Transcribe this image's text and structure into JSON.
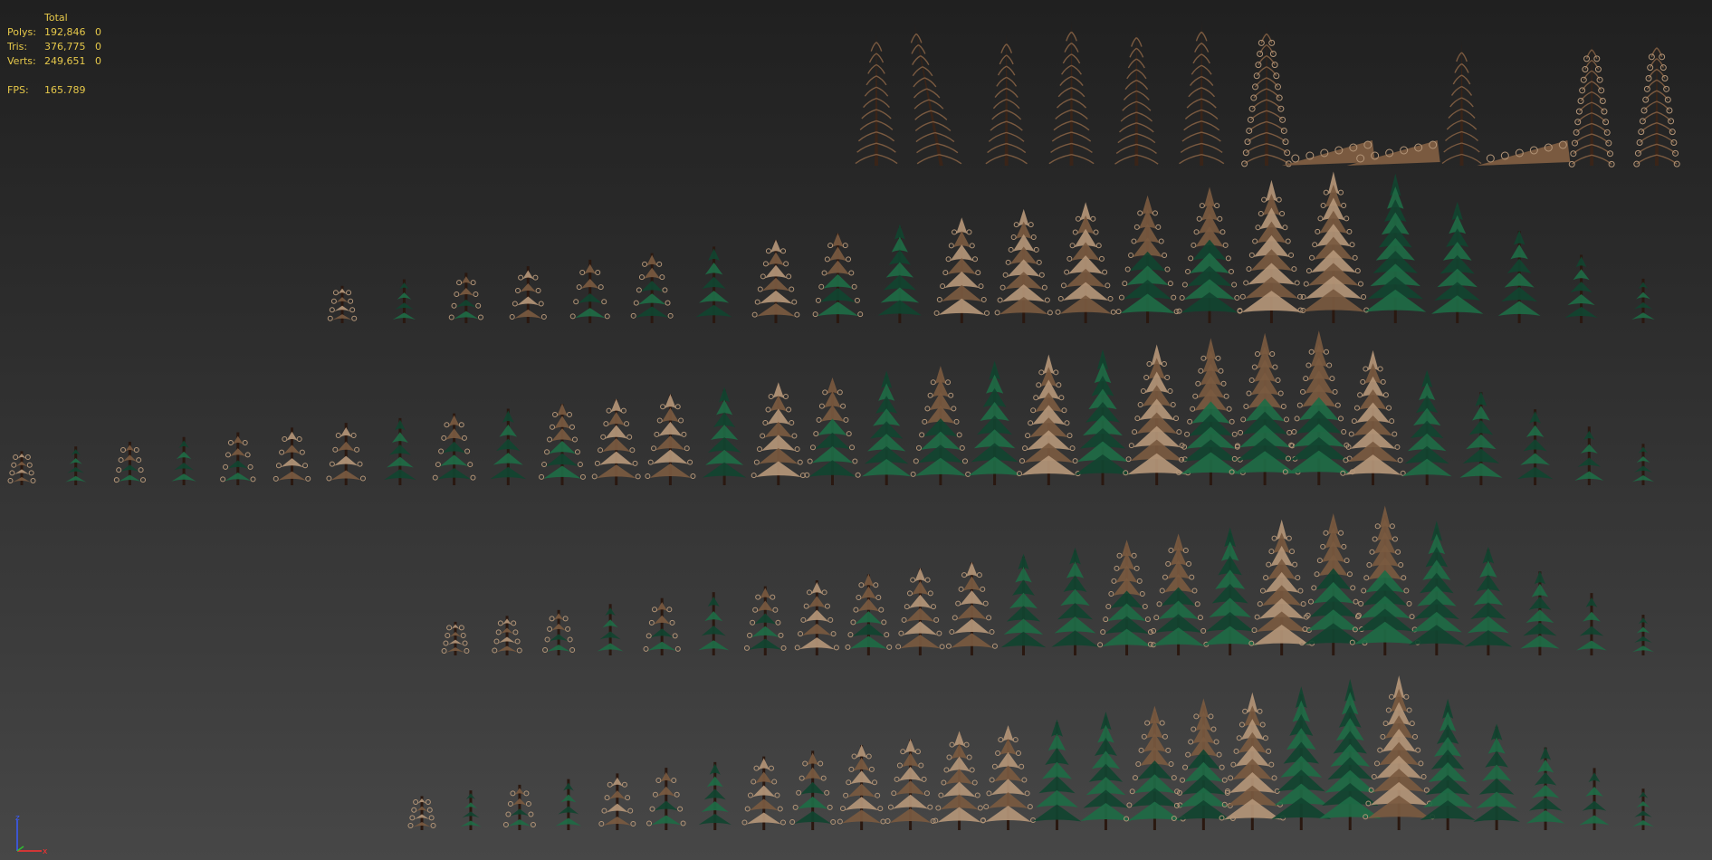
{
  "stats": {
    "header": "Total",
    "rows": [
      {
        "label": "Polys:",
        "total": "192,846",
        "selected": "0"
      },
      {
        "label": "Tris:",
        "total": "376,775",
        "selected": "0"
      },
      {
        "label": "Verts:",
        "total": "249,651",
        "selected": "0"
      }
    ],
    "fps_label": "FPS:",
    "fps_value": "165.789"
  },
  "gizmo": {
    "z_label": "z",
    "x_label": "x",
    "z_color": "#3a5cff",
    "x_color": "#ff3030",
    "y_color": "#30c030"
  },
  "colors": {
    "hud_text": "#e6c84a",
    "tree_green": "#1e6b45",
    "tree_green_dark": "#114430",
    "tree_brown": "#7a5a40",
    "tree_brown_light": "#b49678",
    "trunk": "#2a1810"
  },
  "tree_rows": [
    {
      "name": "row-1-dead-trees",
      "trees": [
        "dead-pine",
        "dead-pine-leaning",
        "dead-pine",
        "dead-pine",
        "dead-pine",
        "dead-pine",
        "curly-pine",
        "fallen-log",
        "fallen-log",
        "dead-sapling",
        "fallen-log",
        "curly-sapling",
        "curly-sapling"
      ]
    },
    {
      "name": "row-2",
      "trees": [
        "brown",
        "green",
        "mixed",
        "brown",
        "mixed",
        "mixed",
        "green",
        "brown",
        "mixed",
        "green",
        "brown",
        "brown",
        "brown",
        "mixed",
        "mixed",
        "brown",
        "brown",
        "green",
        "green",
        "green",
        "green",
        "green"
      ]
    },
    {
      "name": "row-3",
      "trees": [
        "brown",
        "green",
        "mixed",
        "green",
        "mixed",
        "brown",
        "brown",
        "green",
        "mixed",
        "green",
        "mixed",
        "brown",
        "brown",
        "green",
        "brown",
        "mixed",
        "green",
        "mixed",
        "green",
        "brown",
        "green",
        "brown",
        "mixed",
        "mixed",
        "mixed",
        "brown",
        "green",
        "green",
        "green",
        "green",
        "green"
      ]
    },
    {
      "name": "row-4",
      "trees": [
        "brown",
        "brown",
        "mixed",
        "green",
        "mixed",
        "green",
        "mixed",
        "brown",
        "mixed",
        "brown",
        "brown",
        "green",
        "green",
        "mixed",
        "mixed",
        "green",
        "brown",
        "mixed",
        "mixed",
        "green",
        "green",
        "green",
        "green",
        "green"
      ]
    },
    {
      "name": "row-5",
      "trees": [
        "brown",
        "green",
        "mixed",
        "green",
        "brown",
        "mixed",
        "green",
        "brown",
        "mixed",
        "brown",
        "brown",
        "brown",
        "brown",
        "green",
        "green",
        "mixed",
        "mixed",
        "brown",
        "green",
        "green",
        "brown",
        "green",
        "green",
        "green",
        "green",
        "green"
      ]
    }
  ]
}
